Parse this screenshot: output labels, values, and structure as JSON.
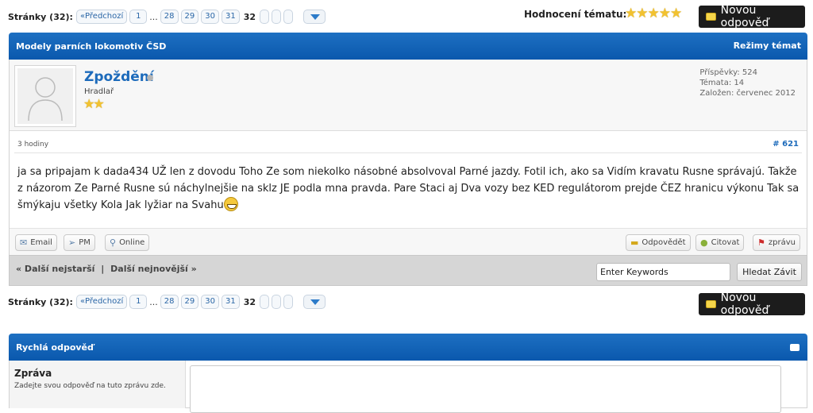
{
  "pagination": {
    "label": "Stránky (32):",
    "prev": "«Předchozí",
    "pages": [
      "1",
      "28",
      "29",
      "30",
      "31"
    ],
    "ellipsis": "...",
    "current": "32"
  },
  "rating": {
    "label": "Hodnocení tématu:",
    "stars": "★★★★★",
    "value_of_5": 5
  },
  "new_reply_label": "Novou odpověď",
  "thread": {
    "title": "Modely parních lokomotiv ČSD",
    "modes_label": "Režimy témat"
  },
  "post": {
    "username": "Zpoždění",
    "user_title": "Hradlař",
    "rank_stars": "★★",
    "stats": {
      "posts": "Příspěvky: 524",
      "threads": "Témata: 14",
      "joined": "Založen: červenec 2012"
    },
    "date": "3 hodiny",
    "number": "# 621",
    "text": "ja sa pripajam k dada434 UŽ len z dovodu Toho Ze som niekolko násobné absolvoval Parné jazdy. Fotil ich, ako sa Vidím kravatu Rusne správajú. Takže z názorom Ze Parné Rusne sú náchylnejšie na sklz JE podla mna pravda. Pare Staci aj Dva vozy bez KED regulátorom prejde ČEZ hranicu výkonu Tak sa šmýkaju všetky Kola Jak lyžiar na Svahu",
    "buttons": {
      "email": "Email",
      "pm": "PM",
      "online": "Online",
      "reply": "Odpovědět",
      "quote": "Citovat",
      "report": "zprávu"
    }
  },
  "nav": {
    "older": "« Další nejstarší",
    "separator": "|",
    "newer": "Další nejnovější »",
    "search_placeholder": "Enter Keywords",
    "search_button": "Hledat Závit"
  },
  "quick_reply": {
    "title": "Rychlá odpověď",
    "message_label": "Zpráva",
    "message_desc": "Zadejte svou odpověď na tuto zprávu zde."
  },
  "colors": {
    "header_blue": "#0a58ad",
    "link_blue": "#1d6bbb",
    "star_gold": "#f2c230",
    "reply_button_bg": "#1c1c1c"
  }
}
